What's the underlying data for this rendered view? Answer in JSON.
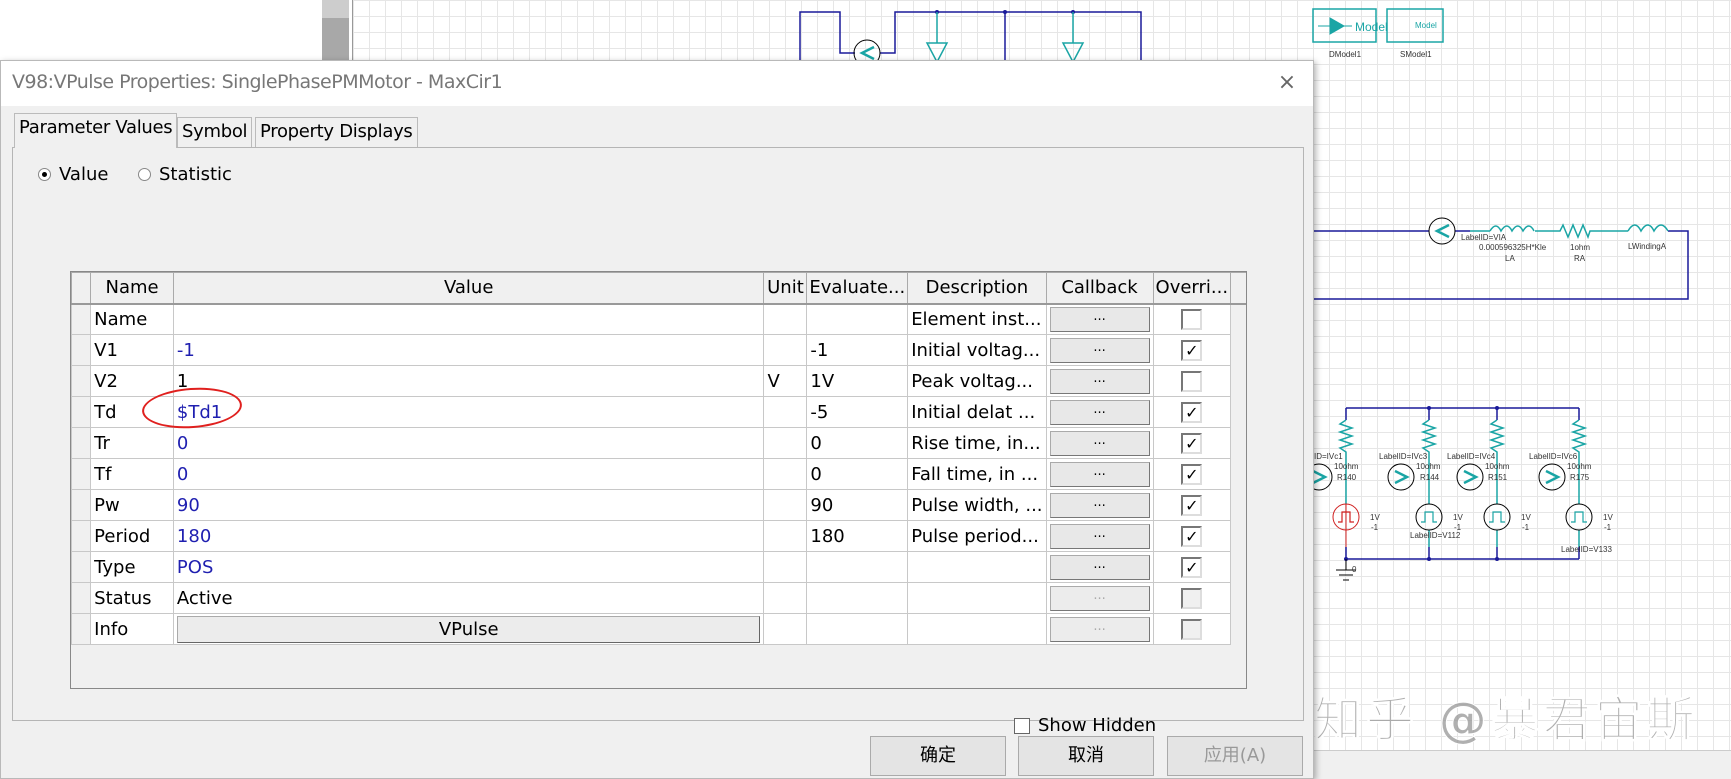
{
  "dialog": {
    "title": "V98:VPulse Properties: SinglePhasePMMotor - MaxCir1",
    "close_icon": "×",
    "tabs": [
      {
        "label": "Parameter Values"
      },
      {
        "label": "Symbol"
      },
      {
        "label": "Property Displays"
      }
    ],
    "mode": {
      "value_label": "Value",
      "statistic_label": "Statistic",
      "selected": "Value"
    },
    "columns": [
      "Name",
      "Value",
      "Unit",
      "Evaluate...",
      "Description",
      "Callback",
      "Overri..."
    ],
    "rows": [
      {
        "name": "Name",
        "value": "",
        "unit": "",
        "evaluated": "",
        "description": "Element inst...",
        "callback": "...",
        "override": false,
        "blue": false,
        "disabled": false
      },
      {
        "name": "V1",
        "value": "-1",
        "unit": "",
        "evaluated": "-1",
        "description": "Initial voltag...",
        "callback": "...",
        "override": true,
        "blue": true,
        "disabled": false
      },
      {
        "name": "V2",
        "value": "1",
        "unit": "V",
        "evaluated": "1V",
        "description": "Peak voltag...",
        "callback": "...",
        "override": false,
        "blue": false,
        "disabled": false
      },
      {
        "name": "Td",
        "value": "$Td1",
        "unit": "",
        "evaluated": "-5",
        "description": "Initial delat ...",
        "callback": "...",
        "override": true,
        "blue": true,
        "disabled": false
      },
      {
        "name": "Tr",
        "value": "0",
        "unit": "",
        "evaluated": "0",
        "description": "Rise time, in...",
        "callback": "...",
        "override": true,
        "blue": true,
        "disabled": false
      },
      {
        "name": "Tf",
        "value": "0",
        "unit": "",
        "evaluated": "0",
        "description": "Fall time, in ...",
        "callback": "...",
        "override": true,
        "blue": true,
        "disabled": false
      },
      {
        "name": "Pw",
        "value": "90",
        "unit": "",
        "evaluated": "90",
        "description": "Pulse width, ...",
        "callback": "...",
        "override": true,
        "blue": true,
        "disabled": false
      },
      {
        "name": "Period",
        "value": "180",
        "unit": "",
        "evaluated": "180",
        "description": "Pulse period...",
        "callback": "...",
        "override": true,
        "blue": true,
        "disabled": false
      },
      {
        "name": "Type",
        "value": "POS",
        "unit": "",
        "evaluated": "",
        "description": "",
        "callback": "...",
        "override": true,
        "blue": true,
        "disabled": false
      },
      {
        "name": "Status",
        "value": "Active",
        "unit": "",
        "evaluated": "",
        "description": "",
        "callback": "...",
        "override": false,
        "blue": false,
        "disabled": true
      },
      {
        "name": "Info",
        "value": "VPulse",
        "unit": "",
        "evaluated": "",
        "description": "",
        "callback": "...",
        "override": false,
        "blue": false,
        "disabled": true,
        "value_is_button": true
      }
    ],
    "show_hidden_label": "Show Hidden",
    "show_hidden": false,
    "ok_label": "确定",
    "cancel_label": "取消",
    "apply_label": "应用(A)"
  },
  "schematic": {
    "dmodel_text": "Model",
    "dmodel_label": "DModel1",
    "smodel_text": "Model",
    "smodel_label": "SModel1",
    "ammeter_label": "LabelID=VIA",
    "la_value": "0.000596325H*Kle",
    "la_label": "LA",
    "ra_value": "1ohm",
    "ra_label": "RA",
    "lwinding_label": "LWindingA",
    "branch_labels": [
      "ID=IVc1",
      "LabelID=IVc3",
      "LabelID=IVc4",
      "LabelID=IVc6"
    ],
    "resistor_value": "10ohm",
    "resistor_names": [
      "R140",
      "R144",
      "R151",
      "R175"
    ],
    "source_v2": "1V",
    "source_v1": "-1",
    "source_labels": [
      "LabelID=V112",
      "LabelID=V133"
    ],
    "ground_label": "0",
    "accent": "#1aa5a5",
    "wire": "#1a1a9a"
  },
  "watermark": "知乎 @暴君宙斯"
}
